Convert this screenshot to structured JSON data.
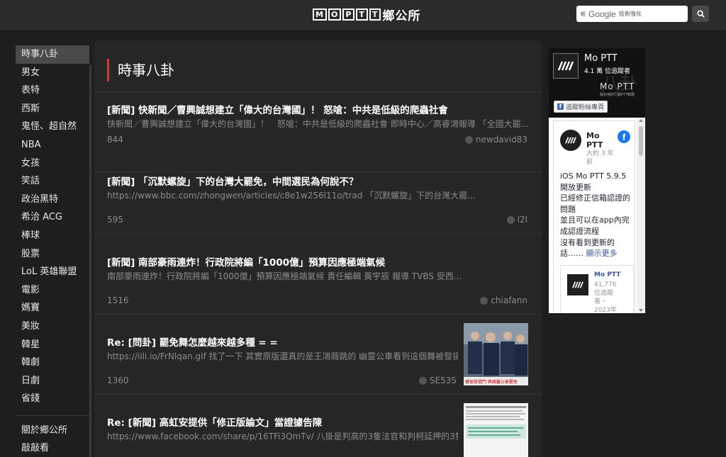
{
  "header": {
    "logo_text": "鄉公所",
    "logo_letters": [
      "M",
      "O",
      "P",
      "T",
      "T"
    ],
    "search": {
      "brand_prefix": "輕",
      "brand": "Google",
      "suffix": "技術強化"
    },
    "search_button_icon": "search-icon"
  },
  "sidebar": {
    "items": [
      {
        "label": "時事八卦",
        "active": true
      },
      {
        "label": "男女"
      },
      {
        "label": "表特"
      },
      {
        "label": "西斯"
      },
      {
        "label": "鬼怪、超自然"
      },
      {
        "label": "NBA"
      },
      {
        "label": "女孩"
      },
      {
        "label": "笑話"
      },
      {
        "label": "政治黑特"
      },
      {
        "label": "希洽 ACG"
      },
      {
        "label": "棒球"
      },
      {
        "label": "股票"
      },
      {
        "label": "LoL 英雄聯盟"
      },
      {
        "label": "電影"
      },
      {
        "label": "媽寶"
      },
      {
        "label": "美妝"
      },
      {
        "label": "韓星"
      },
      {
        "label": "韓劇"
      },
      {
        "label": "日劇"
      },
      {
        "label": "省錢"
      }
    ],
    "footer_items": [
      {
        "label": "關於鄉公所"
      },
      {
        "label": "敲敲看"
      }
    ]
  },
  "main": {
    "title": "時事八卦",
    "posts": [
      {
        "title": "[新聞] 快新聞／曹興誠想建立「偉大的台灣國」！ 怒嗆：中共是低級的爬蟲社會",
        "snippet": "快新聞／曹興誠想建立「偉大的台灣國」！　怒嗆：中共是低級的爬蟲社會 即時中心／高睿鴻報導 「全國大罷...",
        "count": "844",
        "author": "newdavid83"
      },
      {
        "title": "[新聞] 「沉默螺旋」下的台灣大罷免，中間選民為何說不？",
        "snippet": "https://www.bbc.com/zhongwen/articles/c8e1w256l11o/trad 「沉默螺旋」下的台灣大罷...",
        "count": "595",
        "author": "l2l"
      },
      {
        "title": "[新聞] 南部豪雨連炸！行政院將編「1000億」預算因應極端氣候",
        "snippet": "南部豪雨連炸！行政院將編「1000億」預算因應極端氣候 責任編輯 黃宇辰 報導 TVBS 受西...",
        "count": "1516",
        "author": "chiafann"
      },
      {
        "title": "Re: [問卦] 罷免舞怎麼越來越多種 = =",
        "snippet": "https://iili.io/FrNlqan.gif 找了一下 其實原版還真的是王鴻薇跳的 幽靈公車看到這個舞被發揚...",
        "count": "1360",
        "author": "SE535",
        "thumb_caption": "健保掛號門 興國蓋公車罷免"
      },
      {
        "title": "Re: [新聞] 高虹安提供「修正版論文」當證據告陳",
        "snippet": "https://www.facebook.com/share/p/16TFi3QmTv/ 八掛是判高的3隻法官和判柯延押的3隻法...",
        "count": "",
        "author": ""
      }
    ]
  },
  "facebook": {
    "page_name": "Mo PTT",
    "followers": "4.1 萬 位追蹤者",
    "cover_big_text": "八卦",
    "cover_logo_text": "Mo PTT",
    "cover_sub_text": "最好用的行動PTT軟體",
    "follow_button": "追蹤粉絲專頁",
    "post": {
      "name": "Mo PTT",
      "time": "大約 3 年前",
      "text_lines": [
        "iOS Mo PTT 5.9.5 開放更新",
        "已經修正信箱認證的問題",
        "並且可以在app內完成認證流程",
        "沒有看到更新的話……"
      ],
      "more": "顯示更多"
    },
    "share": {
      "name": "Mo PTT",
      "followers": "41,776 位追蹤者・2023年"
    }
  }
}
